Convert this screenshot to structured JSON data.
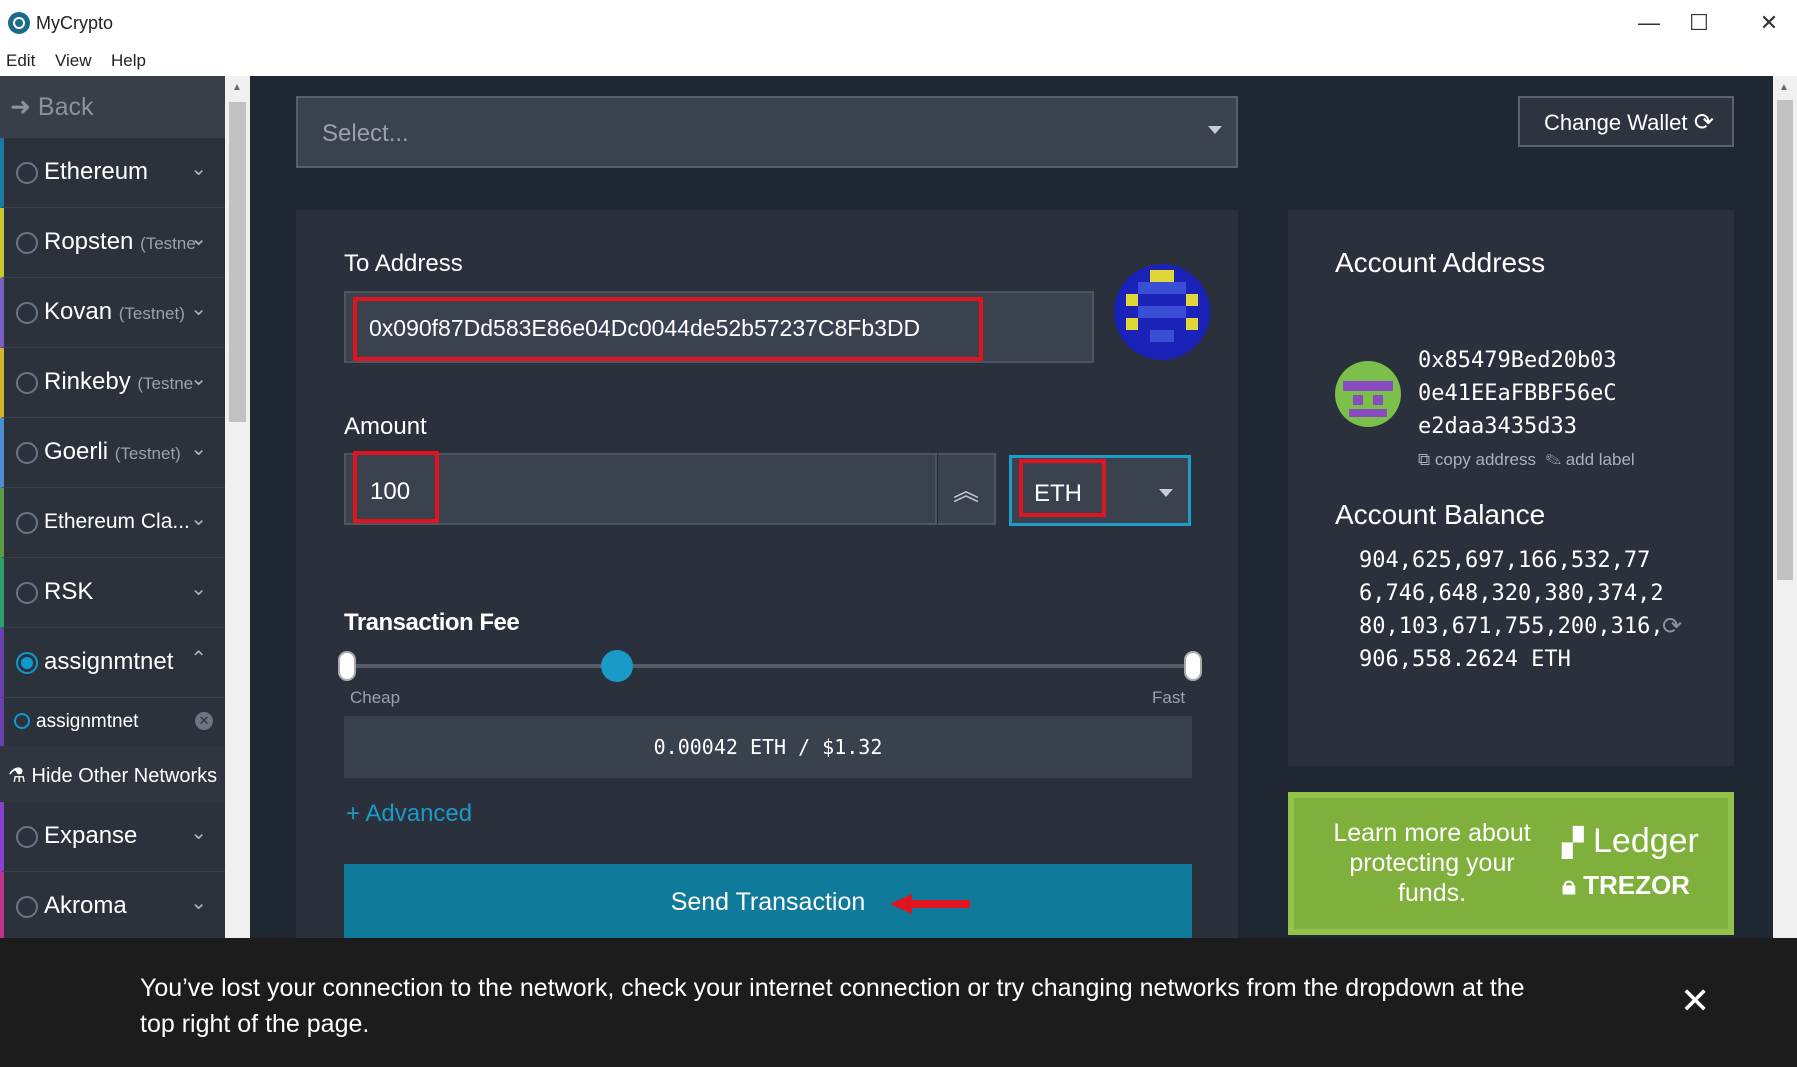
{
  "window": {
    "title": "MyCrypto",
    "minimize": "—",
    "maximize": "☐",
    "close": "✕"
  },
  "menu": [
    "Edit",
    "View",
    "Help"
  ],
  "sidebar": {
    "back_label": "Back",
    "networks": [
      {
        "name": "Ethereum",
        "sub": "",
        "color": "#1a7ca6"
      },
      {
        "name": "Ropsten",
        "sub": "(Testne",
        "color": "#c7c732"
      },
      {
        "name": "Kovan",
        "sub": "(Testnet)",
        "color": "#7b61bf"
      },
      {
        "name": "Rinkeby",
        "sub": "(Testne",
        "color": "#d6b42b"
      },
      {
        "name": "Goerli",
        "sub": "(Testnet)",
        "color": "#4a8fd0"
      },
      {
        "name": "Ethereum Cla...",
        "sub": "",
        "color": "#5c9b47"
      },
      {
        "name": "RSK",
        "sub": "",
        "color": "#2b9f6d"
      },
      {
        "name": "assignmtnet",
        "sub": "",
        "color": "#6a3fb0"
      }
    ],
    "sub_network": "assignmtnet",
    "hide_other": "Hide Other Networks",
    "more_networks": [
      {
        "name": "Expanse",
        "color": "#8a3fd0"
      },
      {
        "name": "Akroma",
        "color": "#c0338a"
      }
    ]
  },
  "main": {
    "select_placeholder": "Select...",
    "change_wallet": "Change Wallet",
    "to_address_label": "To Address",
    "to_address_value": "0x090f87Dd583E86e04Dc0044de52b57237C8Fb3DD",
    "amount_label": "Amount",
    "amount_value": "100",
    "unit": "ETH",
    "tx_fee_label": "Transaction Fee",
    "cheap": "Cheap",
    "fast": "Fast",
    "fee_text": "0.00042 ETH / $1.32",
    "advanced": "+ Advanced",
    "send_button": "Send Transaction"
  },
  "account": {
    "address_title": "Account Address",
    "address": "0x85479Bed20b030e41EEaFBBF56eCe2daa3435d33",
    "copy_address": "copy address",
    "add_label": "add label",
    "balance_title": "Account Balance",
    "balance": "904,625,697,166,532,776,746,648,320,380,374,280,103,671,755,200,316,906,558.2624 ETH"
  },
  "promo": {
    "text": "Learn more about protecting your funds.",
    "ledger": "Ledger",
    "trezor": "TREZOR"
  },
  "notification": {
    "text": "You’ve lost your connection to the network, check your internet connection or try changing networks from the dropdown at the top right of the page."
  },
  "colors": {
    "accent": "#1a9ac7",
    "highlight": "#e0141e",
    "promo_green": "#7fb03c"
  }
}
